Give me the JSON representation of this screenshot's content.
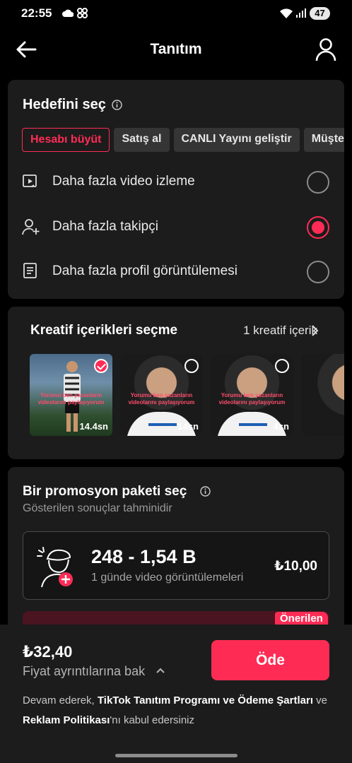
{
  "status_bar": {
    "time": "22:55",
    "battery": "47"
  },
  "header": {
    "title": "Tanıtım"
  },
  "goal": {
    "title": "Hedefini seç",
    "chips": [
      "Hesabı büyüt",
      "Satış al",
      "CANLI Yayını geliştir",
      "Müşte"
    ],
    "active_chip": 0,
    "options": [
      {
        "label": "Daha fazla video izleme",
        "selected": false
      },
      {
        "label": "Daha fazla takipçi",
        "selected": true
      },
      {
        "label": "Daha fazla profil görüntülemesi",
        "selected": false
      }
    ]
  },
  "creative": {
    "title": "Kreatif içerikleri seçme",
    "count": "1 kreatif içerik",
    "thumbs": [
      {
        "overlay": "Yorumu ben yazanların videolarını paylaşıyorum",
        "duration": "14.4sn",
        "selected": true
      },
      {
        "overlay": "Yorumu ben yazanların videolarını paylaşıyorum",
        "duration": "14sn",
        "selected": false
      },
      {
        "overlay": "Yorumu ben yazanların videolarını paylaşıyorum",
        "duration": "4sn",
        "selected": false
      },
      {
        "overlay": "",
        "duration": "",
        "selected": false
      }
    ]
  },
  "package": {
    "title": "Bir promosyon paketi seç",
    "subtitle": "Gösterilen sonuçlar tahminidir",
    "range": "248 - 1,54 B",
    "metric": "1 günde video görüntülemeleri",
    "price": "₺10,00",
    "badge": "Önerilen"
  },
  "checkout": {
    "total": "₺32,40",
    "details": "Fiyat ayrıntılarına bak",
    "pay": "Öde",
    "terms_prefix": "Devam ederek, ",
    "terms_link1": "TikTok Tanıtım Programı ve Ödeme Şartları",
    "terms_mid": " ve ",
    "terms_link2": "Reklam Politikası",
    "terms_suffix": "'nı kabul edersiniz"
  },
  "colors": {
    "accent": "#fe2c55",
    "card": "#1c1c1c",
    "background": "#000000"
  }
}
